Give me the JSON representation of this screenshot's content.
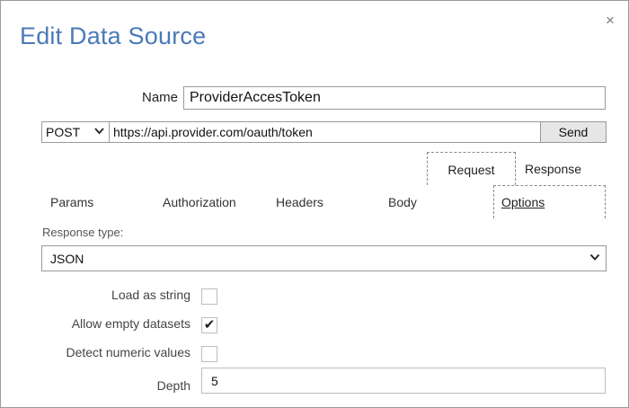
{
  "dialog": {
    "title": "Edit Data Source",
    "close_icon": "×"
  },
  "name": {
    "label": "Name",
    "value": "ProviderAccesToken"
  },
  "request_line": {
    "method": "POST",
    "method_chevron": "⌄",
    "url": "https://api.provider.com/oauth/token",
    "send_label": "Send"
  },
  "top_tabs": {
    "request": "Request",
    "response": "Response"
  },
  "sub_tabs": {
    "params": "Params",
    "authorization": "Authorization",
    "headers": "Headers",
    "body": "Body",
    "options": "Options"
  },
  "options": {
    "response_type_label": "Response type:",
    "response_type_value": "JSON",
    "load_as_string_label": "Load as string",
    "load_as_string_checked": false,
    "allow_empty_label": "Allow empty datasets",
    "allow_empty_checked": true,
    "allow_empty_mark": "✔",
    "detect_numeric_label": "Detect numeric values",
    "detect_numeric_checked": false,
    "depth_label": "Depth",
    "depth_value": "5"
  },
  "colors": {
    "title": "#4a7ab8",
    "border": "#9a9a9a",
    "button_bg": "#e6e6e6"
  }
}
